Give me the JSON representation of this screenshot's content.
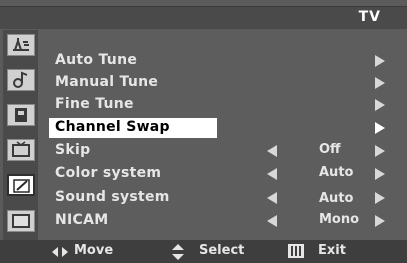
{
  "header": {
    "title": "TV"
  },
  "sidebar": {
    "icons": [
      "antenna-icon",
      "audio-note-icon",
      "clock-icon",
      "tv-input-icon",
      "pencil-icon",
      "screen-icon"
    ],
    "active_index": 4
  },
  "menu": {
    "items": [
      {
        "label": "Auto Tune",
        "value": "",
        "has_left_arrow": false
      },
      {
        "label": "Manual Tune",
        "value": "",
        "has_left_arrow": false
      },
      {
        "label": "Fine Tune",
        "value": "",
        "has_left_arrow": false
      },
      {
        "label": "Channel Swap",
        "value": "",
        "has_left_arrow": false,
        "selected": true
      },
      {
        "label": "Skip",
        "value": "Off",
        "has_left_arrow": true
      },
      {
        "label": "Color system",
        "value": "Auto",
        "has_left_arrow": true
      },
      {
        "label": "Sound system",
        "value": "Auto",
        "has_left_arrow": true
      },
      {
        "label": "NICAM",
        "value": "Mono",
        "has_left_arrow": true
      }
    ]
  },
  "footer": {
    "move_label": "Move",
    "select_label": "Select",
    "exit_label": "Exit"
  },
  "colors": {
    "background": "#5b5b5b",
    "bar": "#4a4a4a",
    "highlight": "#ffffff",
    "text": "#e6e6e6"
  }
}
